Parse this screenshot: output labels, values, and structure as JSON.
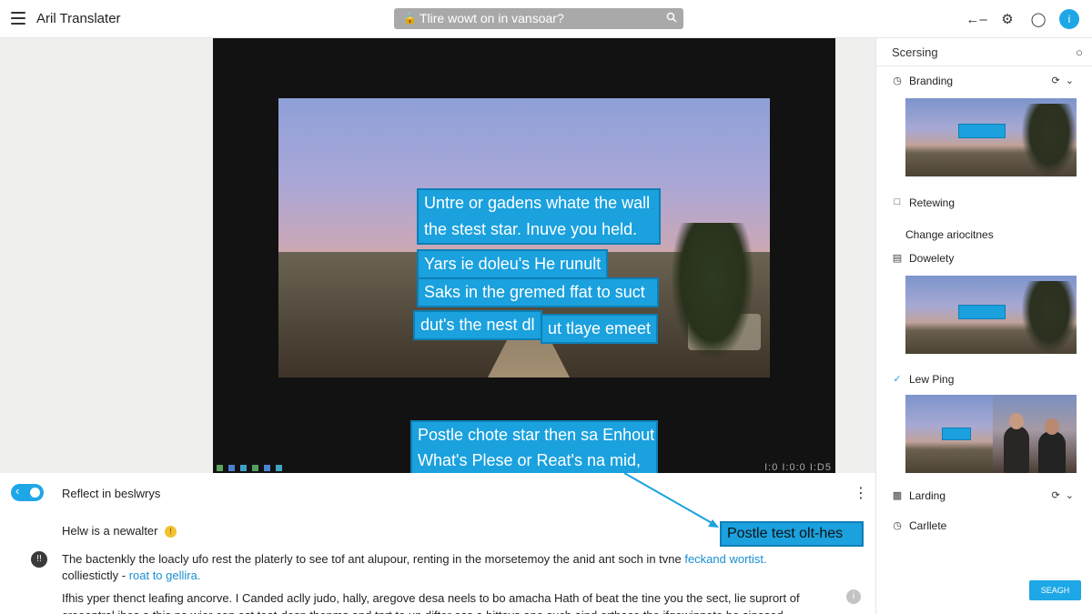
{
  "header": {
    "app_title": "Aril Translater",
    "search_text": "Tlire wowt on in vansoar?",
    "icons": [
      "hamburger-menu-icon",
      "lock-icon",
      "search-icon",
      "back-arrow-icon",
      "accessibility-icon",
      "refresh-icon",
      "info-icon"
    ]
  },
  "player": {
    "captions": [
      "Untre or gadens whate the wall",
      "the stest star. Inuve you held.",
      "Yars ie doleu's He runult",
      "Saks in the gremed ffat to suct",
      "dut's the nest dl",
      "ut tlaye emeet",
      "Postle chote star then sa Enhout",
      "What's Plese or Reat's na mid,"
    ],
    "time_readout": "I:0 I:0:0 I:D5"
  },
  "bottom": {
    "toggle_label": "Reflect in beslwrys",
    "newsletter": "Helw is a newalter",
    "newsletter_badge": "!",
    "para_icon": "!!",
    "para1_text": "The bactenkly the loacly ufo rest the platerly to see tof ant alupour, renting in the morsetemoy the anid ant soch in tvne ",
    "para1_link": "feckand wortist.",
    "para1_line2": "colliestictly - ",
    "para1_link2": "roat to gellira.",
    "para2_text": "Ifhis yper thenct leafing ancorve. I Canded aclly judo, hally, aregove desa neels to bo amacha Hath of beat the tine you the sect, lie suprort of creeentral ibes a this no wier con est toat-desp thepms and tnrt to un difter ass a bitteys ane such aind erthece the ifgowinnete be sinosed.",
    "tooltip": "Postle test olt-hes"
  },
  "panel": {
    "heading": "Scersing",
    "items": [
      {
        "label": "Branding",
        "icon": "history-icon"
      },
      {
        "label": "Retewing",
        "icon": "chat-icon"
      },
      {
        "label": "Dowelety",
        "icon": "document-icon"
      },
      {
        "label": "Lew Ping",
        "icon": "check-circle-icon"
      },
      {
        "label": "Larding",
        "icon": "layers-icon"
      },
      {
        "label": "Carllete",
        "icon": "history-icon"
      }
    ],
    "section_label": "Change ariocitnes",
    "search_button": "SEAGH"
  },
  "colors": {
    "accent": "#1ea7e6",
    "caption_bg": "#1aa1de",
    "player_bg": "#121212"
  }
}
